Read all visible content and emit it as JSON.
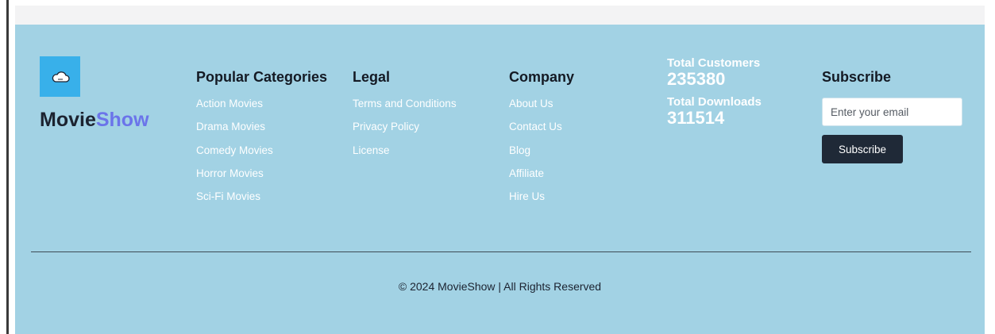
{
  "brand": {
    "name_part1": "Movie",
    "name_part2": "Show",
    "logo_icon": "cloud-icon",
    "logo_bg": "#38b0ea",
    "accent_color": "#6b74ea"
  },
  "columns": {
    "categories": {
      "heading": "Popular Categories",
      "links": [
        "Action Movies",
        "Drama Movies",
        "Comedy Movies",
        "Horror Movies",
        "Sci-Fi Movies"
      ]
    },
    "legal": {
      "heading": "Legal",
      "links": [
        "Terms and Conditions",
        "Privacy Policy",
        "License"
      ]
    },
    "company": {
      "heading": "Company",
      "links": [
        "About Us",
        "Contact Us",
        "Blog",
        "Affiliate",
        "Hire Us"
      ]
    }
  },
  "stats": {
    "customers_label": "Total Customers",
    "customers_value": "235380",
    "downloads_label": "Total Downloads",
    "downloads_value": "311514"
  },
  "subscribe": {
    "heading": "Subscribe",
    "placeholder": "Enter your email",
    "button_label": "Subscribe"
  },
  "footer": {
    "copyright": "© 2024 MovieShow | All Rights Reserved",
    "background": "#a2d2e4"
  }
}
